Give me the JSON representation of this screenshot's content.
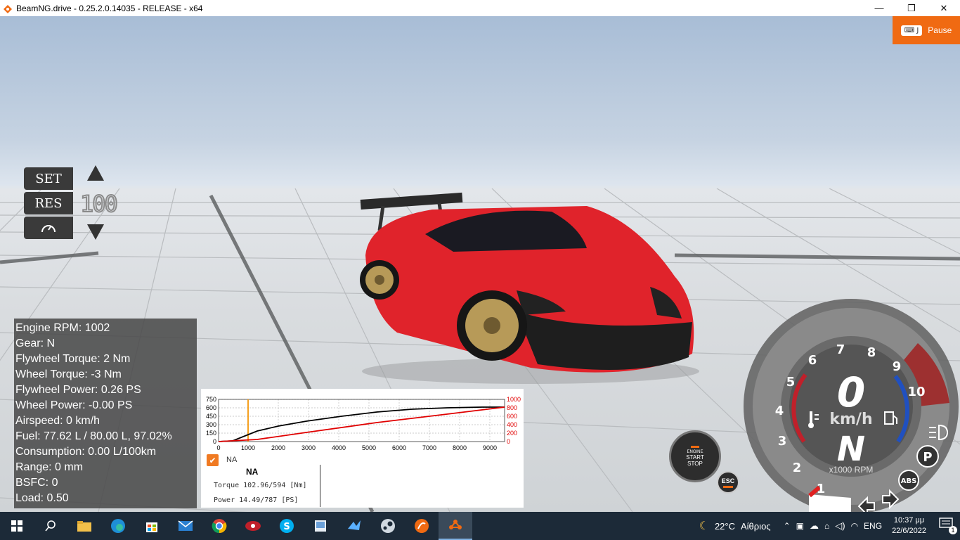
{
  "window": {
    "title": "BeamNG.drive - 0.25.2.0.14035 - RELEASE - x64",
    "minimize": "—",
    "restore": "❐",
    "close": "✕"
  },
  "pause": {
    "key": "J",
    "label": "Pause"
  },
  "cruise_control": {
    "set_label": "SET",
    "res_label": "RES",
    "speed": "100"
  },
  "debug": {
    "lines": [
      "Engine RPM: 1002",
      "Gear: N",
      "Flywheel Torque: 2 Nm",
      "Wheel Torque: -3 Nm",
      "Flywheel Power: 0.26 PS",
      "Wheel Power: -0.00 PS",
      "Airspeed: 0 km/h",
      "Fuel: 77.62 L / 80.00 L, 97.02%",
      "Consumption: 0.00 L/100km",
      "Range: 0 mm",
      "BSFC: 0",
      "Load: 0.50"
    ]
  },
  "torque_chart": {
    "left_ticks": [
      "750",
      "600",
      "450",
      "300",
      "150",
      "0"
    ],
    "right_ticks": [
      "1000",
      "800",
      "600",
      "400",
      "200",
      "0"
    ],
    "x_ticks": [
      "0",
      "1000",
      "2000",
      "3000",
      "4000",
      "5000",
      "6000",
      "7000",
      "8000",
      "9000"
    ],
    "checkbox_label": "NA",
    "legend_title": "NA",
    "torque_label": "Torque",
    "torque_value": "102.96/594",
    "torque_unit": "[Nm]",
    "power_label": "Power",
    "power_value": "14.49/787",
    "power_unit": "[PS]"
  },
  "engine_button": {
    "line1": "ENGINE",
    "line2": "START",
    "line3": "STOP"
  },
  "esc_button": {
    "label": "ESC"
  },
  "dashboard": {
    "speed": "0",
    "speed_unit": "km/h",
    "gear": "N",
    "rpm_unit": "x1000 RPM",
    "rpm_marks": [
      "1",
      "2",
      "3",
      "4",
      "5",
      "6",
      "7",
      "8",
      "9",
      "10"
    ],
    "abs_label": "ABS",
    "park_label": "P"
  },
  "taskbar": {
    "weather_temp": "22°C",
    "weather_text": "Αίθριος",
    "language": "ENG",
    "time": "10:37 μμ",
    "date": "22/6/2022",
    "notification_count": "1"
  },
  "colors": {
    "accent": "#f06a12",
    "taskbar": "#1c2a38",
    "car": "#e0232b",
    "torque_line": "#000000",
    "power_line": "#e00000"
  }
}
